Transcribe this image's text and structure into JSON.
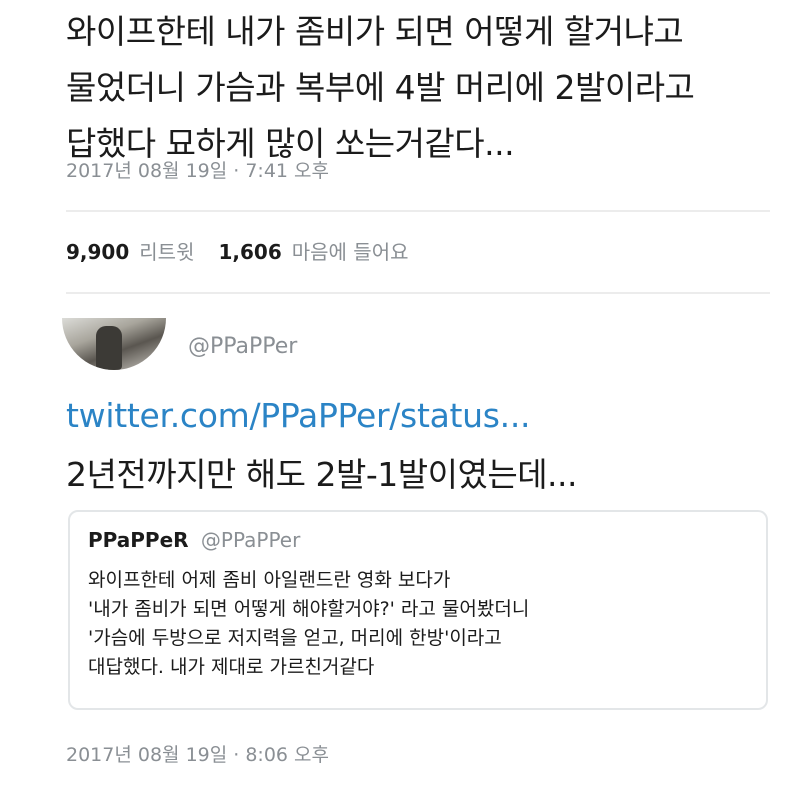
{
  "tweet": {
    "lines": [
      "와이프한테 내가 좀비가 되면 어떻게 할거냐고",
      "물었더니 가슴과 복부에 4발 머리에 2발이라고",
      "답했다 묘하게 많이 쏘는거같다..."
    ],
    "timestamp": "2017년 08월 19일 · 7:41 오후",
    "retweet_count": "9,900",
    "retweet_label": "리트윗",
    "like_count": "1,606",
    "like_label": "마음에 들어요"
  },
  "reply": {
    "handle": "@PPaPPer",
    "link": "twitter.com/PPaPPer/status...",
    "text": "2년전까지만 해도 2발-1발이였는데...",
    "timestamp": "2017년 08월 19일 · 8:06 오후"
  },
  "quoted": {
    "name": "PPaPPeR",
    "handle": "@PPaPPer",
    "lines": [
      "와이프한테 어제 좀비 아일랜드란 영화 보다가",
      "'내가 좀비가 되면 어떻게 해야할거야?' 라고 물어봤더니",
      "'가슴에 두방으로 저지력을 얻고, 머리에 한방'이라고",
      "대답했다. 내가 제대로 가르친거같다"
    ]
  }
}
